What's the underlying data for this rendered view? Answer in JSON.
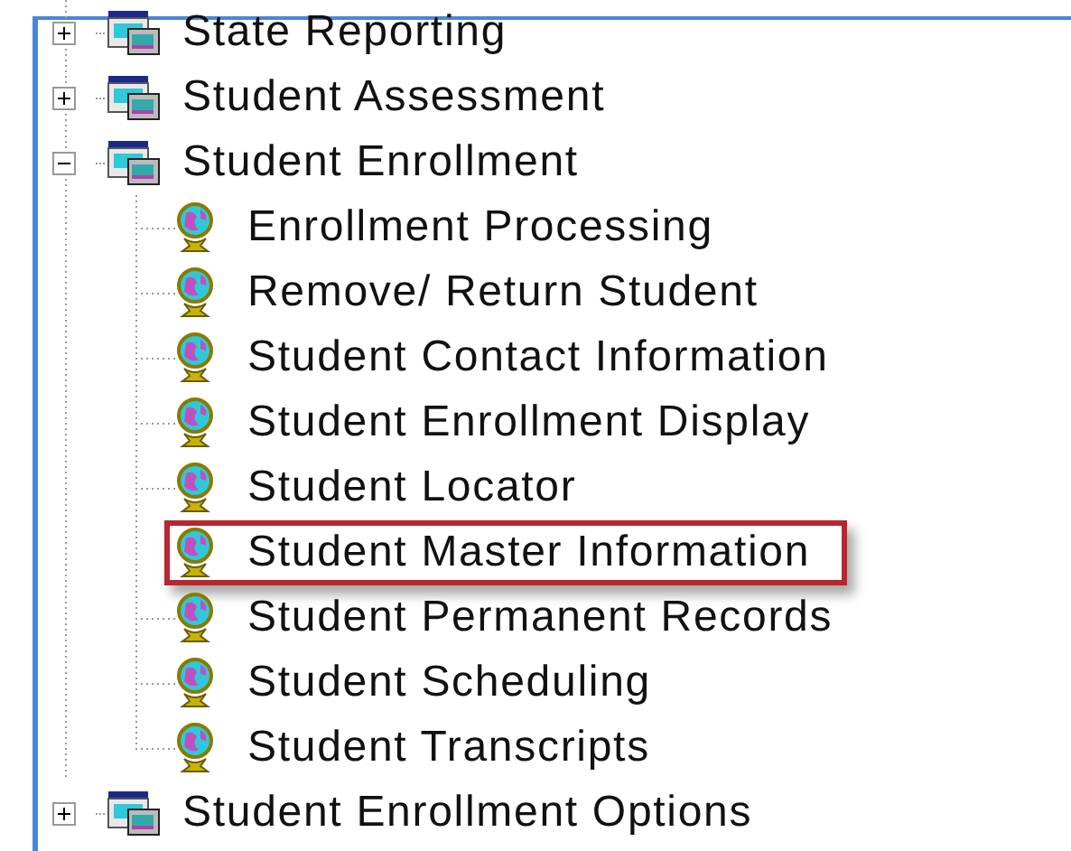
{
  "tree": {
    "items": [
      {
        "label": "State Reporting",
        "expanded": false
      },
      {
        "label": "Student Assessment",
        "expanded": false
      },
      {
        "label": "Student Enrollment",
        "expanded": true,
        "children": [
          {
            "label": "Enrollment Processing",
            "highlighted": false
          },
          {
            "label": "Remove/ Return Student",
            "highlighted": false
          },
          {
            "label": "Student Contact Information",
            "highlighted": false
          },
          {
            "label": "Student Enrollment Display",
            "highlighted": false
          },
          {
            "label": "Student Locator",
            "highlighted": false
          },
          {
            "label": "Student Master Information",
            "highlighted": true
          },
          {
            "label": "Student Permanent Records",
            "highlighted": false
          },
          {
            "label": "Student Scheduling",
            "highlighted": false
          },
          {
            "label": "Student Transcripts",
            "highlighted": false
          }
        ]
      },
      {
        "label": "Student Enrollment Options",
        "expanded": false
      }
    ]
  }
}
